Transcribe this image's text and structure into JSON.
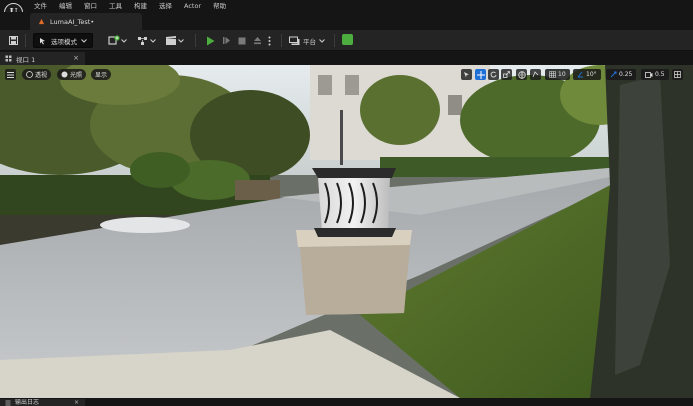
{
  "menubar": {
    "logo": "U",
    "items": [
      "文件",
      "编辑",
      "窗口",
      "工具",
      "构建",
      "选择",
      "Actor",
      "帮助"
    ]
  },
  "tabbar": {
    "doc_tab_label": "LumaAI_Test•"
  },
  "toolbar": {
    "mode_label": "选项模式",
    "platform_label": "平台",
    "play_color": "#4cae3e"
  },
  "viewport_tab": {
    "label": "视口 1",
    "close": "×"
  },
  "viewport": {
    "perspective_label": "透视",
    "lit_label": "光照",
    "show_label": "显示",
    "grid_snap": "10",
    "angle_snap": "10°",
    "scale_snap": "0.25",
    "camera_speed": "0.5"
  },
  "output_tab": {
    "label": "输出日志",
    "close": "×"
  },
  "colors": {
    "accent_blue": "#1e6fd6",
    "toolbar_bg": "#242424",
    "window_bg": "#151515"
  }
}
